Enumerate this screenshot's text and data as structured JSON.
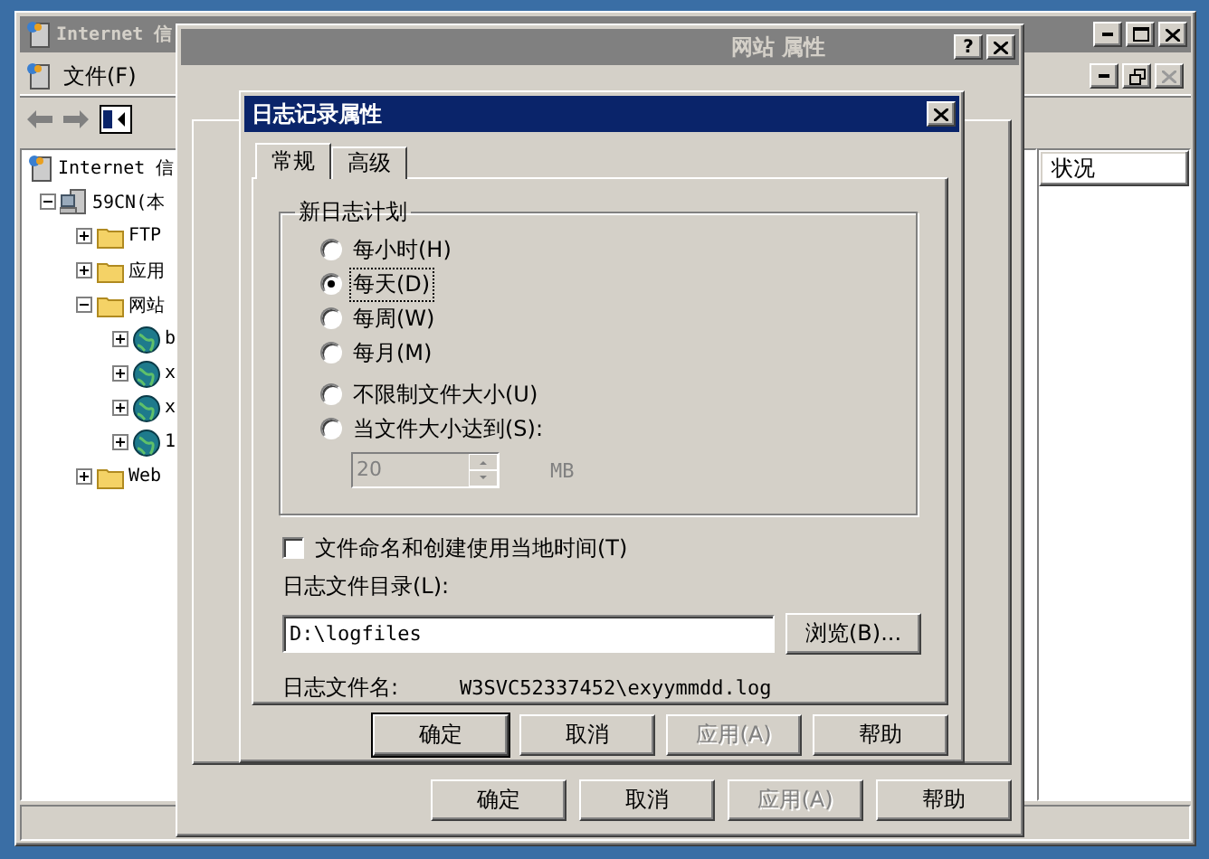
{
  "main_window": {
    "title": "Internet 信",
    "menu": [
      "文件(F)"
    ],
    "tree": [
      {
        "label": "Internet 信",
        "kind": "server",
        "children": [
          {
            "label": "59CN(本",
            "kind": "computer",
            "expanded": true,
            "children": [
              {
                "label": "FTP",
                "kind": "folder",
                "expanded": false
              },
              {
                "label": "应用",
                "kind": "folder",
                "expanded": false
              },
              {
                "label": "网站",
                "kind": "folder",
                "expanded": true,
                "children": [
                  {
                    "label": "b",
                    "kind": "site",
                    "expanded": false
                  },
                  {
                    "label": "x",
                    "kind": "site",
                    "expanded": false
                  },
                  {
                    "label": "x",
                    "kind": "site",
                    "expanded": false
                  },
                  {
                    "label": "1",
                    "kind": "site",
                    "expanded": false
                  }
                ]
              },
              {
                "label": "Web",
                "kind": "folder",
                "expanded": false
              }
            ]
          }
        ]
      }
    ],
    "list_columns": [
      "状况"
    ]
  },
  "site_dialog": {
    "title": "网站 属性",
    "help_button": "?",
    "buttons": [
      {
        "label": "确定",
        "disabled": false
      },
      {
        "label": "取消",
        "disabled": false
      },
      {
        "label": "应用(A)",
        "disabled": true
      },
      {
        "label": "帮助",
        "disabled": false
      }
    ]
  },
  "log_dialog": {
    "title": "日志记录属性",
    "tabs": [
      {
        "label": "常规",
        "selected": true
      },
      {
        "label": "高级",
        "selected": false
      }
    ],
    "schedule": {
      "title": "新日志计划",
      "options": [
        {
          "label": "每小时(H)",
          "selected": false
        },
        {
          "label": "每天(D)",
          "selected": true
        },
        {
          "label": "每周(W)",
          "selected": false
        },
        {
          "label": "每月(M)",
          "selected": false
        },
        {
          "label": "不限制文件大小(U)",
          "selected": false
        },
        {
          "label": "当文件大小达到(S):",
          "selected": false
        }
      ],
      "size_value": "20",
      "size_unit": "MB",
      "size_disabled": true
    },
    "local_time": {
      "label": "文件命名和创建使用当地时间(T)",
      "checked": false
    },
    "directory_label": "日志文件目录(L):",
    "directory_value": "D:\\logfiles",
    "browse_button": "浏览(B)...",
    "filename_label": "日志文件名:",
    "filename_value": "W3SVC52337452\\exyymmdd.log",
    "buttons": [
      {
        "label": "确定",
        "disabled": false,
        "default": true
      },
      {
        "label": "取消",
        "disabled": false,
        "default": false
      },
      {
        "label": "应用(A)",
        "disabled": true,
        "default": false
      },
      {
        "label": "帮助",
        "disabled": false,
        "default": false
      }
    ]
  }
}
